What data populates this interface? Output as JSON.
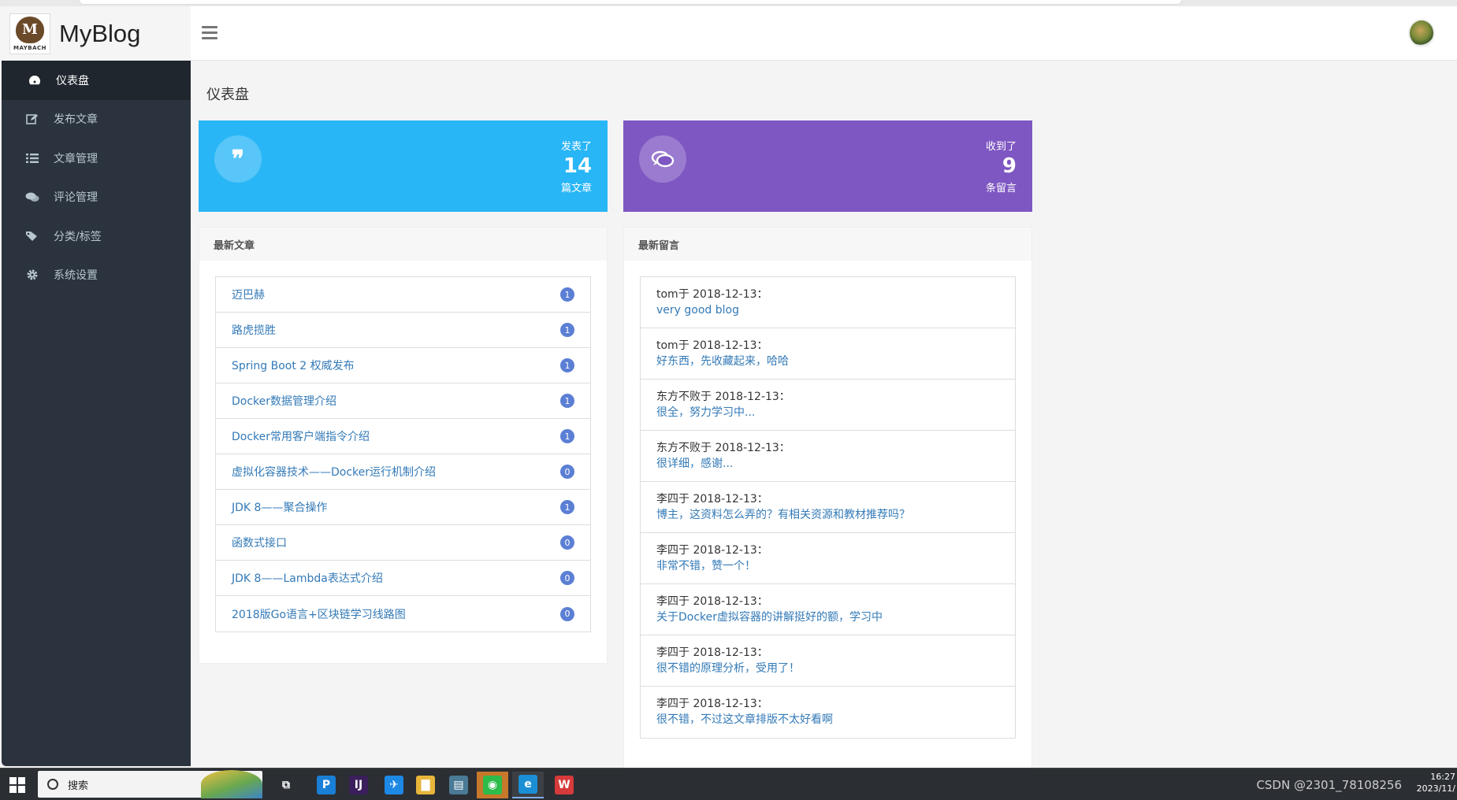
{
  "brand": {
    "name": "MyBlog",
    "logo_text": "MAYBACH",
    "logo_mark": "M"
  },
  "sidebar": {
    "items": [
      {
        "label": "仪表盘",
        "icon": "dashboard-icon",
        "active": true
      },
      {
        "label": "发布文章",
        "icon": "edit-icon",
        "active": false
      },
      {
        "label": "文章管理",
        "icon": "list-icon",
        "active": false
      },
      {
        "label": "评论管理",
        "icon": "comments-icon",
        "active": false
      },
      {
        "label": "分类/标签",
        "icon": "tags-icon",
        "active": false
      },
      {
        "label": "系统设置",
        "icon": "gear-icon",
        "active": false
      }
    ]
  },
  "page": {
    "title": "仪表盘"
  },
  "stats": {
    "posts": {
      "label_top": "发表了",
      "value": "14",
      "label_bottom": "篇文章",
      "icon": "quote-icon",
      "color": "#29b6f6"
    },
    "comments": {
      "label_top": "收到了",
      "value": "9",
      "label_bottom": "条留言",
      "icon": "chat-icon",
      "color": "#7e57c2"
    }
  },
  "latest_posts": {
    "title": "最新文章",
    "items": [
      {
        "title": "迈巴赫",
        "count": "1"
      },
      {
        "title": "路虎揽胜",
        "count": "1"
      },
      {
        "title": "Spring Boot 2 权威发布",
        "count": "1"
      },
      {
        "title": "Docker数据管理介绍",
        "count": "1"
      },
      {
        "title": "Docker常用客户端指令介绍",
        "count": "1"
      },
      {
        "title": "虚拟化容器技术——Docker运行机制介绍",
        "count": "0"
      },
      {
        "title": "JDK 8——聚合操作",
        "count": "1"
      },
      {
        "title": "函数式接口",
        "count": "0"
      },
      {
        "title": "JDK 8——Lambda表达式介绍",
        "count": "0"
      },
      {
        "title": "2018版Go语言+区块链学习线路图",
        "count": "0"
      }
    ]
  },
  "latest_comments": {
    "title": "最新留言",
    "items": [
      {
        "who": "tom于 2018-12-13：",
        "text": "very good blog"
      },
      {
        "who": "tom于 2018-12-13：",
        "text": "好东西，先收藏起来，哈哈"
      },
      {
        "who": "东方不败于 2018-12-13：",
        "text": "很全，努力学习中..."
      },
      {
        "who": "东方不败于 2018-12-13：",
        "text": "很详细，感谢..."
      },
      {
        "who": "李四于 2018-12-13：",
        "text": "博主，这资料怎么弄的？有相关资源和教材推荐吗？"
      },
      {
        "who": "李四于 2018-12-13：",
        "text": "非常不错，赞一个！"
      },
      {
        "who": "李四于 2018-12-13：",
        "text": "关于Docker虚拟容器的讲解挺好的额，学习中"
      },
      {
        "who": "李四于 2018-12-13：",
        "text": "很不错的原理分析，受用了！"
      },
      {
        "who": "李四于 2018-12-13：",
        "text": "很不错，不过这文章排版不太好看啊"
      }
    ]
  },
  "taskbar": {
    "search_placeholder": "搜索",
    "apps": [
      {
        "name": "task-view-icon",
        "glyph": "⧉",
        "color": "#2b2e33"
      },
      {
        "name": "pycharm-icon",
        "glyph": "P",
        "color": "#1a7fd6"
      },
      {
        "name": "intellij-icon",
        "glyph": "IJ",
        "color": "#3a1f5c"
      },
      {
        "name": "feishu-icon",
        "glyph": "✈",
        "color": "#1e88e5"
      },
      {
        "name": "file-explorer-icon",
        "glyph": "▇",
        "color": "#e6b53a"
      },
      {
        "name": "notepad-icon",
        "glyph": "▤",
        "color": "#4a7a96"
      },
      {
        "name": "wechat-icon",
        "glyph": "◉",
        "color": "#2dbb4a"
      },
      {
        "name": "edge-icon",
        "glyph": "e",
        "color": "#1a8fd6"
      },
      {
        "name": "wps-icon",
        "glyph": "W",
        "color": "#d63a3a"
      }
    ],
    "tray_text": "CSDN @2301_78108256",
    "time": "16:27",
    "date": "2023/11/"
  }
}
